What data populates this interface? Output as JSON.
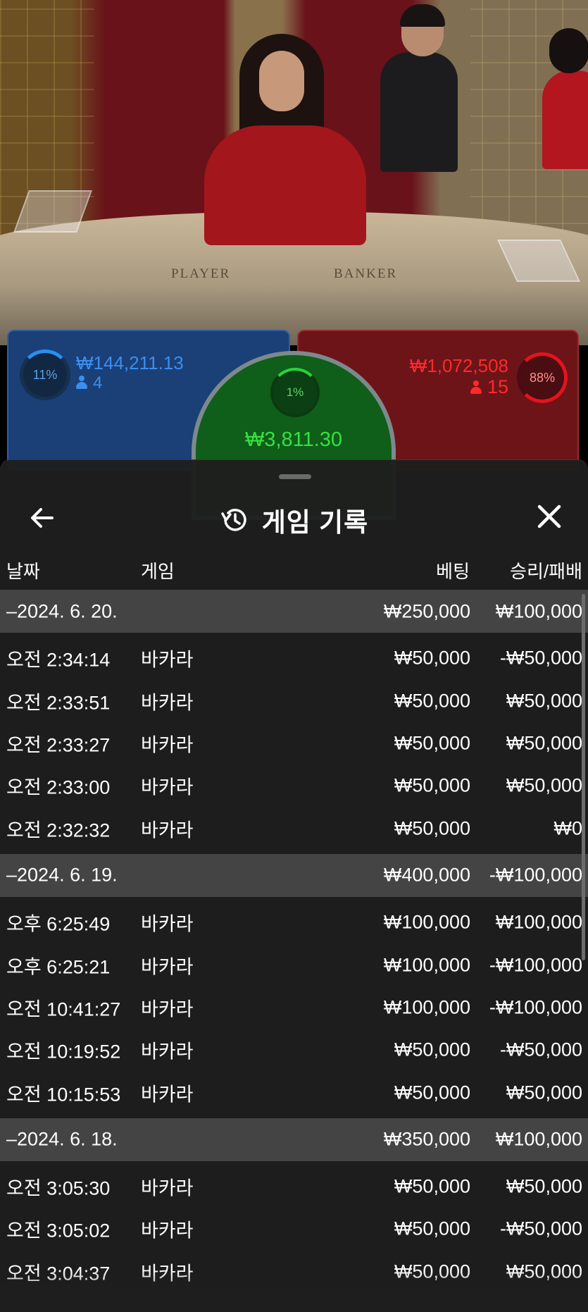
{
  "live": {
    "table_labels": {
      "player": "PLAYER",
      "banker": "BANKER"
    },
    "player": {
      "percent": "11%",
      "amount": "₩144,211.13",
      "count": "4"
    },
    "tie": {
      "percent": "1%",
      "amount": "₩3,811.30"
    },
    "banker": {
      "percent": "88%",
      "amount": "₩1,072,508",
      "count": "15"
    }
  },
  "sheet": {
    "title": "게임 기록",
    "icons": {
      "back": "arrow-left-icon",
      "history": "history-icon",
      "close": "close-icon"
    },
    "columns": {
      "date": "날짜",
      "game": "게임",
      "bet": "베팅",
      "result": "승리/패배"
    },
    "groups": [
      {
        "date": "–2024. 6. 20.",
        "bet": "₩250,000",
        "result": "₩100,000",
        "rows": [
          {
            "time": "오전 2:34:14",
            "game": "바카라",
            "bet": "₩50,000",
            "result": "-₩50,000"
          },
          {
            "time": "오전 2:33:51",
            "game": "바카라",
            "bet": "₩50,000",
            "result": "₩50,000"
          },
          {
            "time": "오전 2:33:27",
            "game": "바카라",
            "bet": "₩50,000",
            "result": "₩50,000"
          },
          {
            "time": "오전 2:33:00",
            "game": "바카라",
            "bet": "₩50,000",
            "result": "₩50,000"
          },
          {
            "time": "오전 2:32:32",
            "game": "바카라",
            "bet": "₩50,000",
            "result": "₩0"
          }
        ]
      },
      {
        "date": "–2024. 6. 19.",
        "bet": "₩400,000",
        "result": "-₩100,000",
        "rows": [
          {
            "time": "오후 6:25:49",
            "game": "바카라",
            "bet": "₩100,000",
            "result": "₩100,000"
          },
          {
            "time": "오후 6:25:21",
            "game": "바카라",
            "bet": "₩100,000",
            "result": "-₩100,000"
          },
          {
            "time": "오전 10:41:27",
            "game": "바카라",
            "bet": "₩100,000",
            "result": "-₩100,000"
          },
          {
            "time": "오전 10:19:52",
            "game": "바카라",
            "bet": "₩50,000",
            "result": "-₩50,000"
          },
          {
            "time": "오전 10:15:53",
            "game": "바카라",
            "bet": "₩50,000",
            "result": "₩50,000"
          }
        ]
      },
      {
        "date": "–2024. 6. 18.",
        "bet": "₩350,000",
        "result": "₩100,000",
        "rows": [
          {
            "time": "오전 3:05:30",
            "game": "바카라",
            "bet": "₩50,000",
            "result": "₩50,000"
          },
          {
            "time": "오전 3:05:02",
            "game": "바카라",
            "bet": "₩50,000",
            "result": "-₩50,000"
          },
          {
            "time": "오전 3:04:37",
            "game": "바카라",
            "bet": "₩50,000",
            "result": "₩50,000"
          }
        ]
      }
    ]
  }
}
